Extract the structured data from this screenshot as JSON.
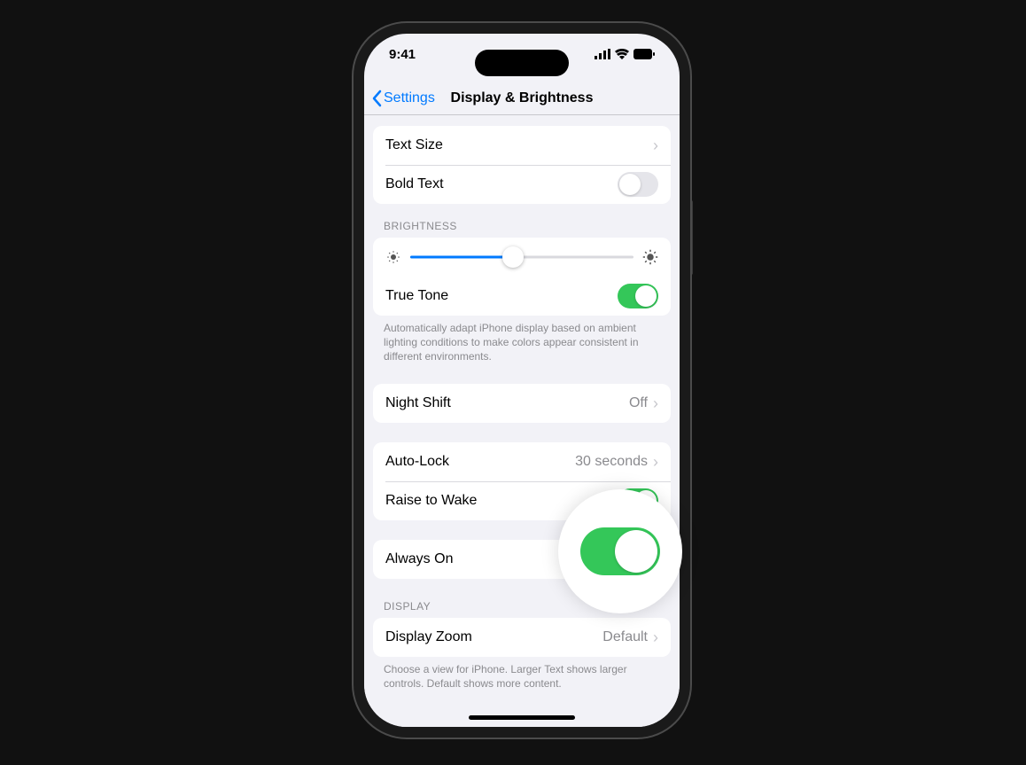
{
  "status": {
    "time": "9:41"
  },
  "nav": {
    "back_label": "Settings",
    "title": "Display & Brightness"
  },
  "section_top": {
    "text_size": "Text Size",
    "bold_text": "Bold Text",
    "bold_text_on": false
  },
  "brightness": {
    "header": "BRIGHTNESS",
    "level_percent": 46,
    "true_tone": "True Tone",
    "true_tone_on": true,
    "footer": "Automatically adapt iPhone display based on ambient lighting conditions to make colors appear consistent in different environments."
  },
  "night_shift": {
    "label": "Night Shift",
    "value": "Off"
  },
  "auto_lock": {
    "label": "Auto-Lock",
    "value": "30 seconds"
  },
  "raise_to_wake": {
    "label": "Raise to Wake",
    "on": true
  },
  "always_on": {
    "label": "Always On",
    "on": true
  },
  "display_zoom": {
    "header": "DISPLAY",
    "label": "Display Zoom",
    "value": "Default",
    "footer": "Choose a view for iPhone. Larger Text shows larger controls. Default shows more content."
  },
  "colors": {
    "accent": "#007aff",
    "toggle_on": "#34c759"
  }
}
